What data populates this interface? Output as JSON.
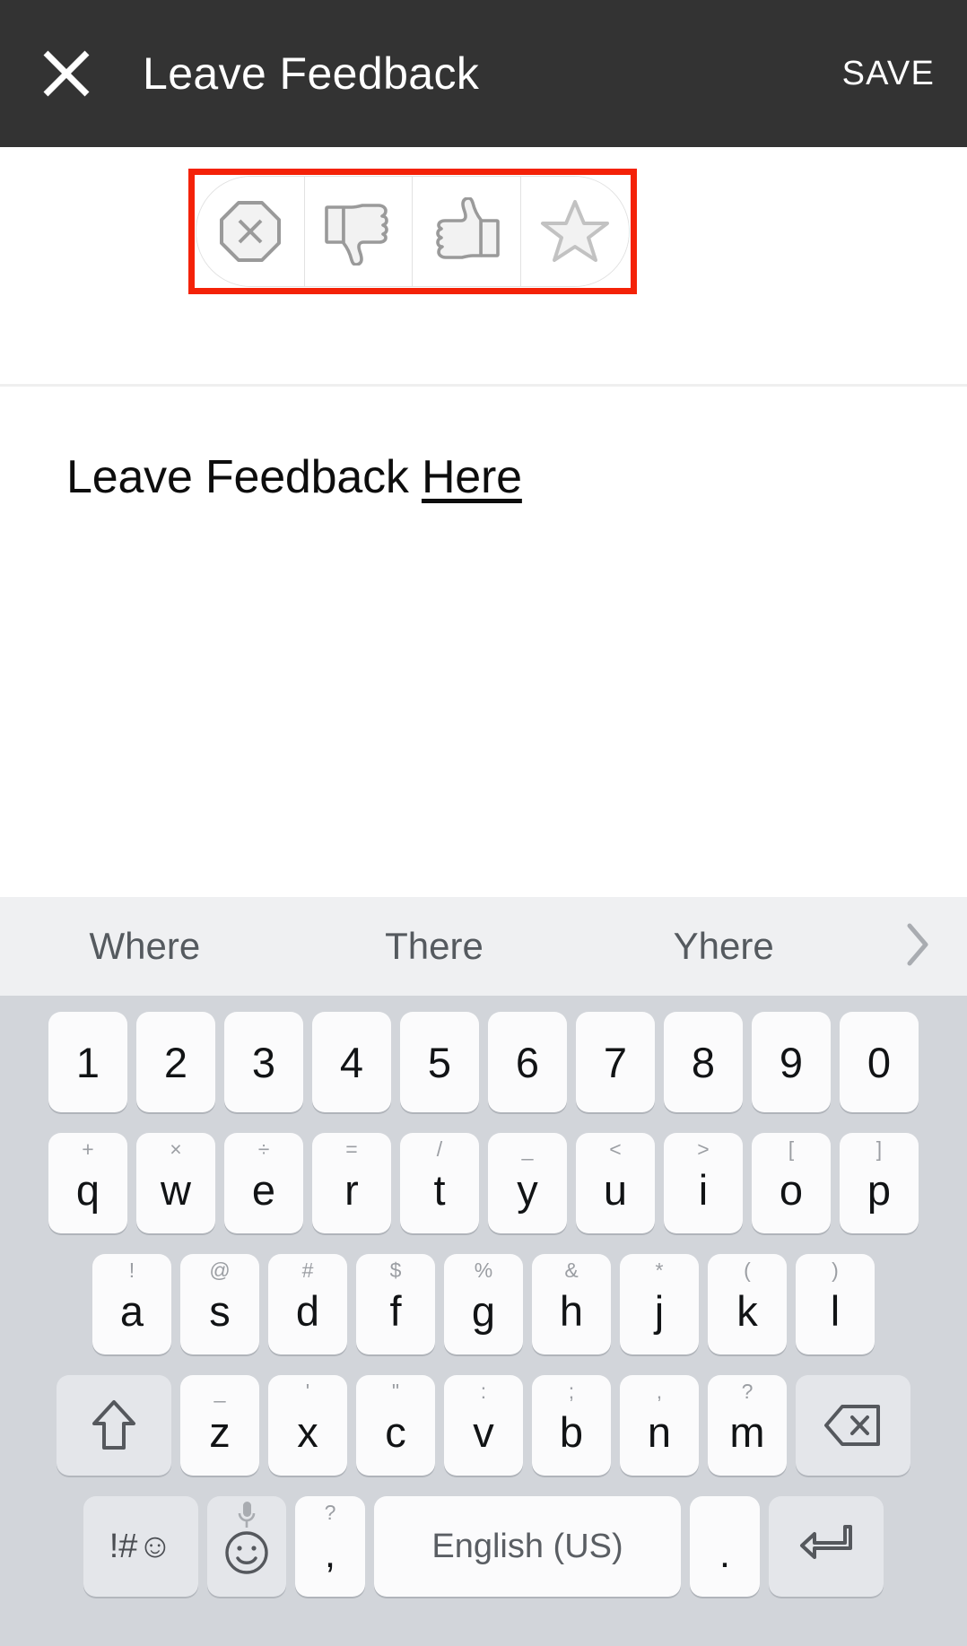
{
  "appbar": {
    "close_icon": "close-x-icon",
    "title": "Leave Feedback",
    "save_label": "SAVE"
  },
  "rating": {
    "highlight_color": "#f42208",
    "options": [
      {
        "id": "block",
        "icon": "octagon-x-icon",
        "label": "Block"
      },
      {
        "id": "thumbs-down",
        "icon": "thumbs-down-icon",
        "label": "Thumbs Down"
      },
      {
        "id": "thumbs-up",
        "icon": "thumbs-up-icon",
        "label": "Thumbs Up"
      },
      {
        "id": "star",
        "icon": "star-icon",
        "label": "Star"
      }
    ]
  },
  "editor": {
    "text_plain": "Leave Feedback ",
    "text_composing": "Here",
    "placeholder": "Leave Feedback Here"
  },
  "keyboard": {
    "suggestions": [
      "Where",
      "There",
      "Yhere"
    ],
    "expand_icon": "chevron-right-icon",
    "row_numbers": [
      {
        "main": "1"
      },
      {
        "main": "2"
      },
      {
        "main": "3"
      },
      {
        "main": "4"
      },
      {
        "main": "5"
      },
      {
        "main": "6"
      },
      {
        "main": "7"
      },
      {
        "main": "8"
      },
      {
        "main": "9"
      },
      {
        "main": "0"
      }
    ],
    "row_top": [
      {
        "main": "q",
        "alt": "+"
      },
      {
        "main": "w",
        "alt": "×"
      },
      {
        "main": "e",
        "alt": "÷"
      },
      {
        "main": "r",
        "alt": "="
      },
      {
        "main": "t",
        "alt": "/"
      },
      {
        "main": "y",
        "alt": "_"
      },
      {
        "main": "u",
        "alt": "<"
      },
      {
        "main": "i",
        "alt": ">"
      },
      {
        "main": "o",
        "alt": "["
      },
      {
        "main": "p",
        "alt": "]"
      }
    ],
    "row_home": [
      {
        "main": "a",
        "alt": "!"
      },
      {
        "main": "s",
        "alt": "@"
      },
      {
        "main": "d",
        "alt": "#"
      },
      {
        "main": "f",
        "alt": "$"
      },
      {
        "main": "g",
        "alt": "%"
      },
      {
        "main": "h",
        "alt": "&"
      },
      {
        "main": "j",
        "alt": "*"
      },
      {
        "main": "k",
        "alt": "("
      },
      {
        "main": "l",
        "alt": ")"
      }
    ],
    "row_bottom": [
      {
        "main": "z",
        "alt": "_"
      },
      {
        "main": "x",
        "alt": "'"
      },
      {
        "main": "c",
        "alt": "\""
      },
      {
        "main": "v",
        "alt": ":"
      },
      {
        "main": "b",
        "alt": ";"
      },
      {
        "main": "n",
        "alt": ","
      },
      {
        "main": "m",
        "alt": "?"
      }
    ],
    "shift_icon": "shift-arrow-icon",
    "backspace_icon": "backspace-icon",
    "symbols_label": "!#☺",
    "emoji_icon": "emoji-smiley-icon",
    "mic_icon": "microphone-icon",
    "comma": {
      "main": ",",
      "alt": "?"
    },
    "space_label": "English (US)",
    "period": {
      "main": "."
    },
    "enter_icon": "enter-return-icon"
  }
}
